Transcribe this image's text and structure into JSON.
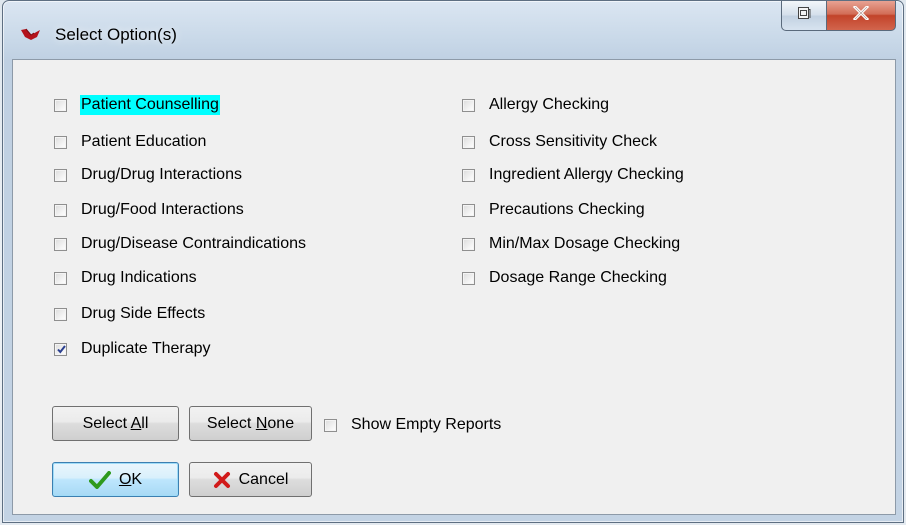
{
  "window": {
    "title": "Select Option(s)",
    "restore_icon": "restore-window-icon",
    "close_icon": "close-x-icon"
  },
  "left_options": [
    {
      "label": "Patient Counselling",
      "checked": false,
      "highlighted": true
    },
    {
      "label": "Patient Education",
      "checked": false
    },
    {
      "label": "Drug/Drug Interactions",
      "checked": false
    },
    {
      "label": "Drug/Food Interactions",
      "checked": false
    },
    {
      "label": "Drug/Disease Contraindications",
      "checked": false
    },
    {
      "label": "Drug Indications",
      "checked": false
    },
    {
      "label": "Drug Side Effects",
      "checked": false
    },
    {
      "label": "Duplicate Therapy",
      "checked": true
    }
  ],
  "right_options": [
    {
      "label": "Allergy Checking",
      "checked": false
    },
    {
      "label": "Cross Sensitivity Check",
      "checked": false
    },
    {
      "label": "Ingredient Allergy Checking",
      "checked": false
    },
    {
      "label": "Precautions Checking",
      "checked": false
    },
    {
      "label": "Min/Max Dosage Checking",
      "checked": false
    },
    {
      "label": "Dosage Range Checking",
      "checked": false
    }
  ],
  "buttons": {
    "select_all": {
      "pre": "Select ",
      "key": "A",
      "post": "ll"
    },
    "select_none": {
      "pre": "Select ",
      "key": "N",
      "post": "one"
    },
    "ok": {
      "pre": "",
      "key": "O",
      "post": "K",
      "icon": "check-icon"
    },
    "cancel": {
      "pre": "",
      "key": "",
      "post": "Cancel",
      "icon": "red-x-icon"
    }
  },
  "show_empty_reports": {
    "label": "Show Empty Reports",
    "checked": false
  },
  "colors": {
    "highlight": "#00ffff",
    "check_mark": "#2a3f8f",
    "ok_icon": "#2e9a1e",
    "cancel_icon": "#d11a1a"
  }
}
